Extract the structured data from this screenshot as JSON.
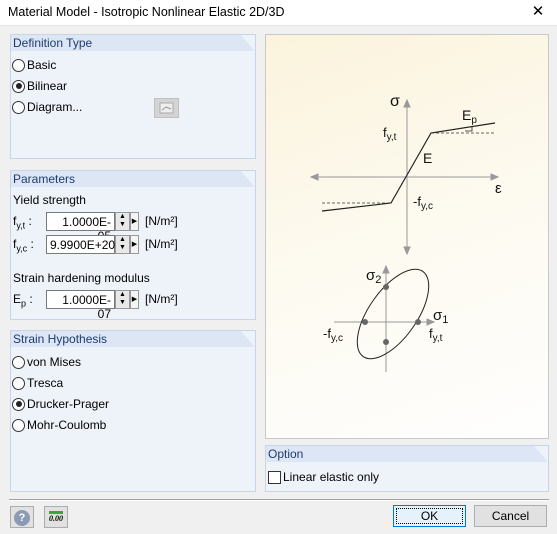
{
  "window": {
    "title": "Material Model - Isotropic Nonlinear Elastic 2D/3D",
    "close": "✕"
  },
  "definition_type": {
    "header": "Definition Type",
    "options": [
      {
        "label": "Basic",
        "selected": false
      },
      {
        "label": "Bilinear",
        "selected": true
      },
      {
        "label": "Diagram...",
        "selected": false
      }
    ]
  },
  "parameters": {
    "header": "Parameters",
    "yield_label": "Yield strength",
    "rows": [
      {
        "sym": "f",
        "sub": "y,t",
        "value": "1.0000E-05",
        "unit": "[N/m²]"
      },
      {
        "sym": "f",
        "sub": "y,c",
        "value": "9.9900E+20",
        "unit": "[N/m²]"
      }
    ],
    "hardening_label": "Strain hardening modulus",
    "ep": {
      "sym": "E",
      "sub": "p",
      "value": "1.0000E-07",
      "unit": "[N/m²]"
    }
  },
  "strain_hypothesis": {
    "header": "Strain Hypothesis",
    "options": [
      {
        "label": "von Mises",
        "selected": false
      },
      {
        "label": "Tresca",
        "selected": false
      },
      {
        "label": "Drucker-Prager",
        "selected": true
      },
      {
        "label": "Mohr-Coulomb",
        "selected": false
      }
    ]
  },
  "diagram": {
    "sigma": "σ",
    "epsilon": "ε",
    "fyt": "f",
    "fyt_sub": "y,t",
    "E": "E",
    "Ep": "E",
    "Ep_sub": "p",
    "mfyc": "-f",
    "mfyc_sub": "y,c",
    "s1": "σ",
    "s1_sub": "1",
    "s2": "σ",
    "s2_sub": "2"
  },
  "option": {
    "header": "Option",
    "linear_elastic": {
      "label": "Linear elastic only",
      "checked": false
    }
  },
  "footer": {
    "ok": "OK",
    "cancel": "Cancel",
    "units_icon_text": "0.00",
    "help_icon_text": "?"
  }
}
